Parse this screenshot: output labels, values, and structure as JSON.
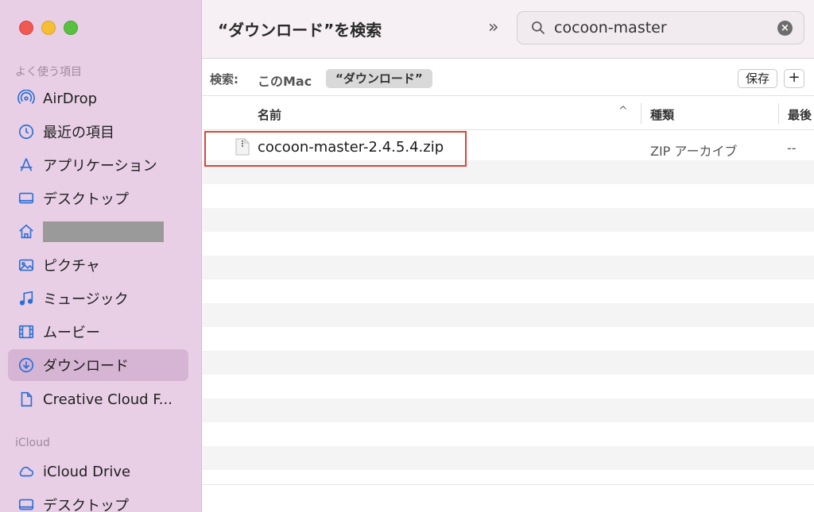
{
  "sidebar": {
    "favorites_heading": "よく使う項目",
    "icloud_heading": "iCloud",
    "items": [
      {
        "label": "AirDrop",
        "icon": "airdrop-icon"
      },
      {
        "label": "最近の項目",
        "icon": "clock-icon"
      },
      {
        "label": "アプリケーション",
        "icon": "applications-icon"
      },
      {
        "label": "デスクトップ",
        "icon": "desktop-icon"
      },
      {
        "label": "",
        "icon": "home-icon"
      },
      {
        "label": "ピクチャ",
        "icon": "photo-icon"
      },
      {
        "label": "ミュージック",
        "icon": "music-icon"
      },
      {
        "label": "ムービー",
        "icon": "film-icon"
      },
      {
        "label": "ダウンロード",
        "icon": "download-icon"
      },
      {
        "label": "Creative Cloud F...",
        "icon": "document-icon"
      }
    ],
    "icloud_items": [
      {
        "label": "iCloud Drive",
        "icon": "cloud-icon"
      },
      {
        "label": "デスクトップ",
        "icon": "desktop-icon"
      }
    ]
  },
  "toolbar": {
    "title": "“ダウンロード”を検索",
    "overflow": "»",
    "search_value": "cocoon-master",
    "clear": "×"
  },
  "scope": {
    "label": "検索:",
    "this_mac": "このMac",
    "downloads": "“ダウンロード”",
    "save": "保存",
    "add": "+"
  },
  "table": {
    "col_name": "名前",
    "col_kind": "種類",
    "col_date": "最後",
    "sort_indicator": "^",
    "rows": [
      {
        "name": "cocoon-master-2.4.5.4.zip",
        "kind": "ZIP アーカイブ",
        "date": "--"
      }
    ]
  },
  "colors": {
    "sidebar_bg": "#e8cfe6",
    "accent_blue": "#2b6fd6",
    "highlight_border": "#d9473a"
  }
}
